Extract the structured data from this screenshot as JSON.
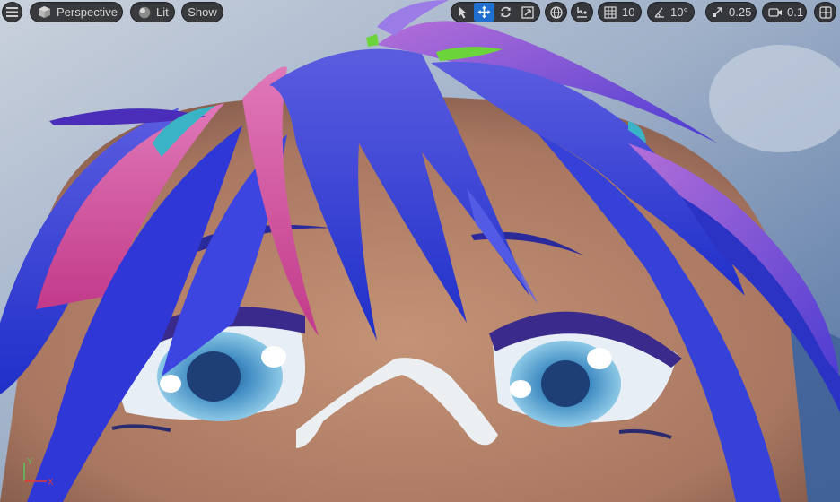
{
  "toolbar": {
    "menu_icon": "hamburger-icon",
    "perspective_label": "Perspective",
    "lit_label": "Lit",
    "show_label": "Show",
    "grid_snap_value": "10",
    "rotation_snap_value": "10°",
    "scale_snap_value": "0.25",
    "camera_speed_value": "0.1"
  },
  "axis": {
    "y_label": "Y",
    "x_label": "X"
  },
  "colors": {
    "toolbar_bg": "#262628",
    "active_tool": "#1f6fd1",
    "axis_x": "#e23b3b",
    "axis_y": "#5bc05b"
  }
}
